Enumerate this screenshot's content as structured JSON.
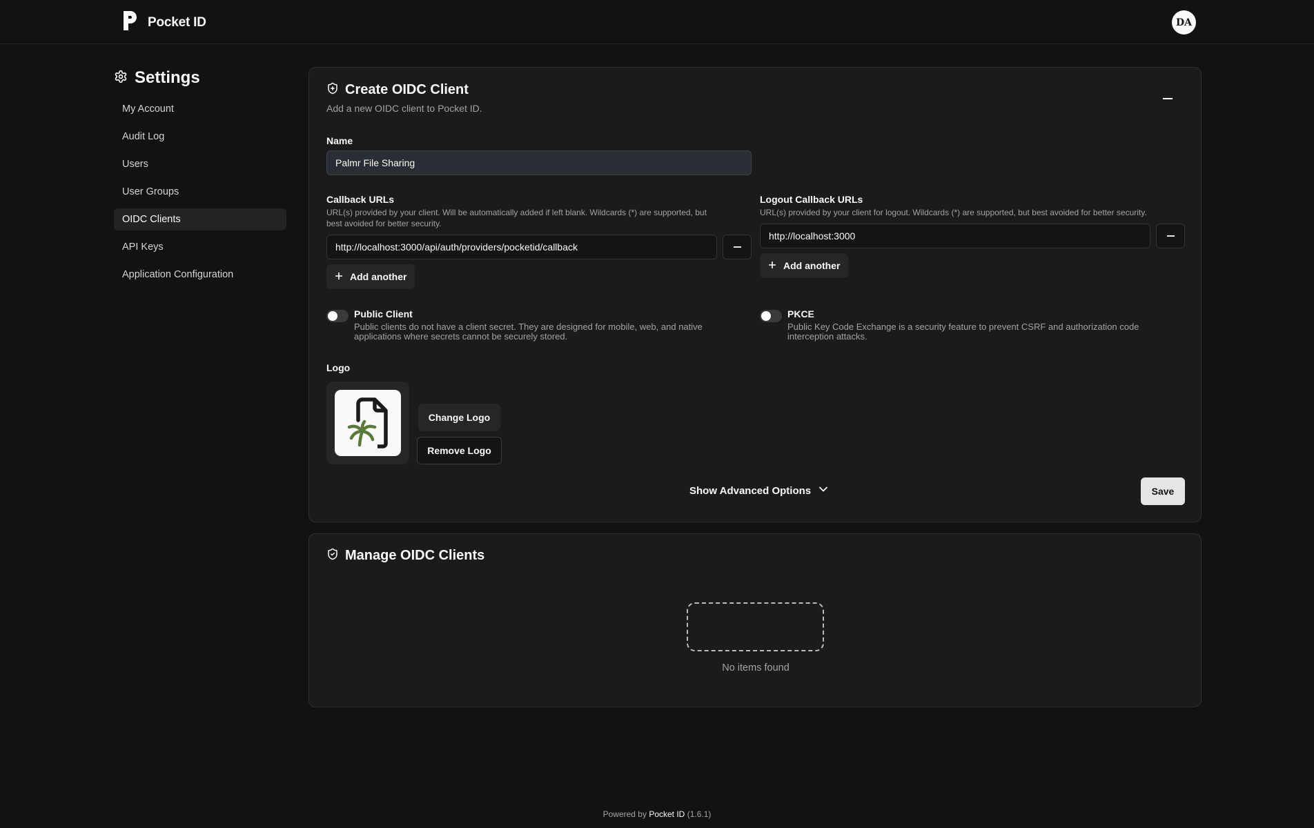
{
  "app": {
    "name": "Pocket ID",
    "avatar_initials": "DA"
  },
  "sidebar": {
    "title": "Settings",
    "items": [
      {
        "label": "My Account",
        "active": false
      },
      {
        "label": "Audit Log",
        "active": false
      },
      {
        "label": "Users",
        "active": false
      },
      {
        "label": "User Groups",
        "active": false
      },
      {
        "label": "OIDC Clients",
        "active": true
      },
      {
        "label": "API Keys",
        "active": false
      },
      {
        "label": "Application Configuration",
        "active": false
      }
    ]
  },
  "create_card": {
    "title": "Create OIDC Client",
    "description": "Add a new OIDC client to Pocket ID.",
    "name_label": "Name",
    "name_value": "Palmr File Sharing",
    "callback": {
      "label": "Callback URLs",
      "hint_line1": "URL(s) provided by your client. Will be automatically added if left blank. Wildcards (*) are supported, but",
      "hint_line2": "best avoided for better security.",
      "value": "http://localhost:3000/api/auth/providers/pocketid/callback",
      "add_label": "Add another"
    },
    "logout_callback": {
      "label": "Logout Callback URLs",
      "hint": "URL(s) provided by your client for logout. Wildcards (*) are supported, but best avoided for better security.",
      "value": "http://localhost:3000",
      "add_label": "Add another"
    },
    "public_client": {
      "label": "Public Client",
      "desc_line1": "Public clients do not have a client secret. They are designed for mobile, web, and native",
      "desc_line2": "applications where secrets cannot be securely stored.",
      "enabled": false
    },
    "pkce": {
      "label": "PKCE",
      "desc_line1": "Public Key Code Exchange is a security feature to prevent CSRF and authorization code",
      "desc_line2": "interception attacks.",
      "enabled": false
    },
    "logo_label": "Logo",
    "change_logo_label": "Change Logo",
    "remove_logo_label": "Remove Logo",
    "advanced_label": "Show Advanced Options",
    "save_label": "Save"
  },
  "manage_card": {
    "title": "Manage OIDC Clients",
    "empty_text": "No items found"
  },
  "footer": {
    "prefix": "Powered by",
    "brand": "Pocket ID",
    "version": "(1.6.1)"
  },
  "colors": {
    "background": "#121212",
    "card": "#1b1b1b",
    "accent": "#fafafa",
    "logo_green": "#5a7a3a"
  }
}
